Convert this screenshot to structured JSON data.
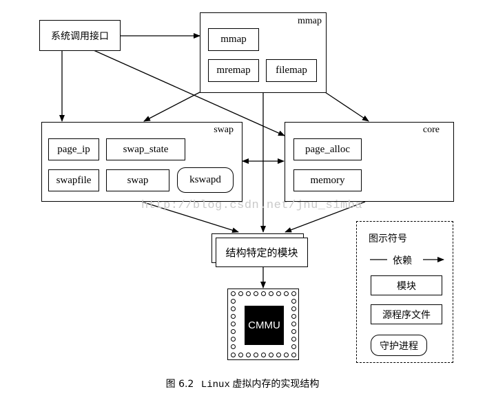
{
  "syscall": {
    "label": "系统调用接口"
  },
  "mmap_group": {
    "title": "mmap",
    "modules": [
      "mmap",
      "mremap",
      "filemap"
    ]
  },
  "swap_group": {
    "title": "swap",
    "modules": [
      "page_ip",
      "swap_state",
      "swapfile",
      "swap"
    ],
    "daemon": "kswapd"
  },
  "core_group": {
    "title": "core",
    "modules": [
      "page_alloc",
      "memory"
    ]
  },
  "arch_module": {
    "label": "结构特定的模块"
  },
  "chip": {
    "label": "CMMU"
  },
  "legend": {
    "title": "图示符号",
    "dependency": "依赖",
    "module": "模块",
    "source_file": "源程序文件",
    "daemon": "守护进程"
  },
  "watermark": "http://blog.csdn.net/jnu_simba",
  "caption": {
    "figure": "图 6.2",
    "text_en": "Linux",
    "text_cn": "虚拟内存的实现结构"
  }
}
